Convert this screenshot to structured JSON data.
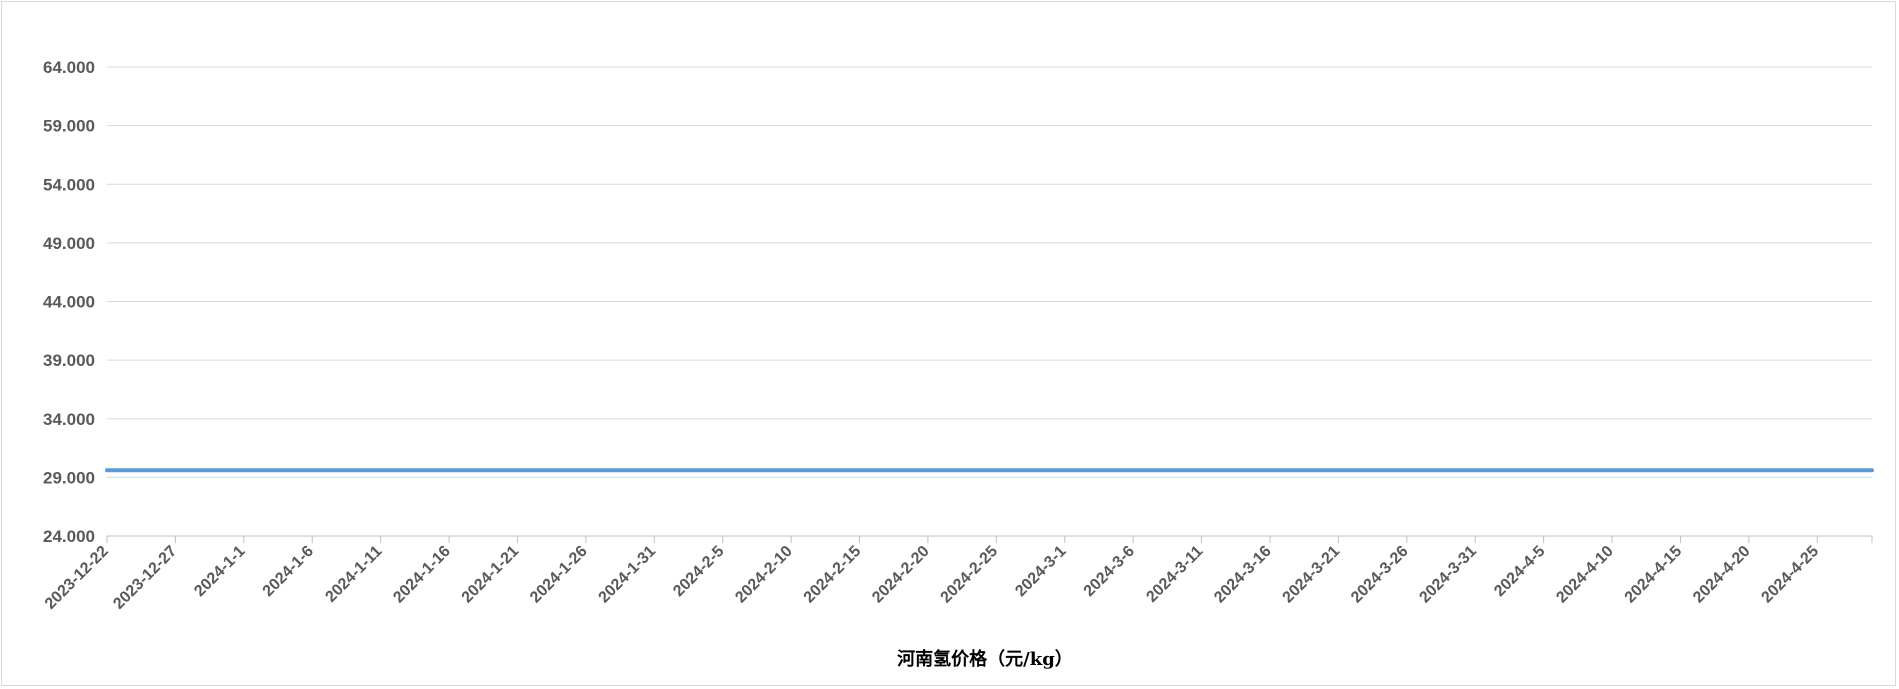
{
  "chart_data": {
    "type": "line",
    "title": "",
    "xlabel": "河南氢价格（元/kg）",
    "ylabel": "",
    "ylim": [
      24,
      64
    ],
    "yticks": [
      "24.000",
      "29.000",
      "34.000",
      "39.000",
      "44.000",
      "49.000",
      "54.000",
      "59.000",
      "64.000"
    ],
    "ytick_values": [
      24,
      29,
      34,
      39,
      44,
      49,
      54,
      59,
      64
    ],
    "xlim": [
      "2023-12-22",
      "2024-4-29"
    ],
    "xticks": [
      "2023-12-22",
      "2023-12-27",
      "2024-1-1",
      "2024-1-6",
      "2024-1-11",
      "2024-1-16",
      "2024-1-21",
      "2024-1-26",
      "2024-1-31",
      "2024-2-5",
      "2024-2-10",
      "2024-2-15",
      "2024-2-20",
      "2024-2-25",
      "2024-3-1",
      "2024-3-6",
      "2024-3-11",
      "2024-3-16",
      "2024-3-21",
      "2024-3-26",
      "2024-3-31",
      "2024-4-5",
      "2024-4-10",
      "2024-4-15",
      "2024-4-20",
      "2024-4-25"
    ],
    "grid": true,
    "legend": "none",
    "series": [
      {
        "color": "#5b9bd5",
        "x": [
          "2023-12-22",
          "2024-4-29"
        ],
        "values": [
          29.6,
          29.6
        ]
      }
    ]
  }
}
